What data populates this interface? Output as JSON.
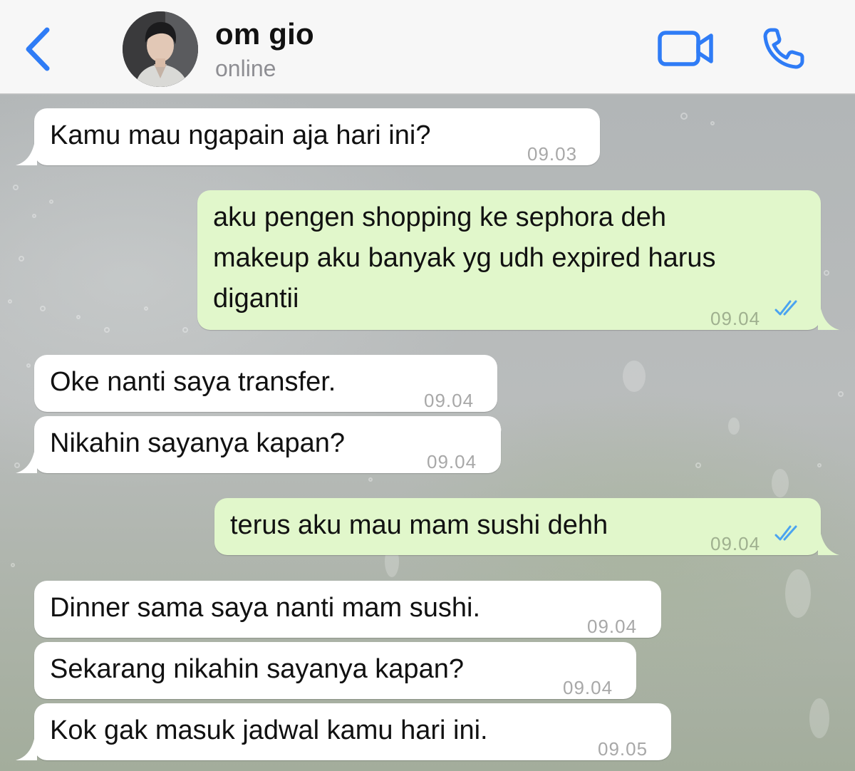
{
  "header": {
    "contact_name": "om gio",
    "status": "online"
  },
  "colors": {
    "accent": "#2f7cf6",
    "incoming_bubble": "#ffffff",
    "outgoing_bubble": "#e1f7cb",
    "read_ticks": "#4aa3f0"
  },
  "icons": {
    "back": "chevron-left-icon",
    "video": "video-camera-icon",
    "call": "phone-icon",
    "read": "double-check-icon"
  },
  "messages": [
    {
      "direction": "incoming",
      "lines": [
        "Kamu mau ngapain aja hari ini?"
      ],
      "time": "09.03"
    },
    {
      "direction": "outgoing",
      "lines": [
        "aku pengen shopping ke sephora deh",
        "makeup aku banyak yg udh expired harus",
        "digantii"
      ],
      "time": "09.04",
      "status": "read"
    },
    {
      "direction": "incoming",
      "lines": [
        "Oke nanti saya transfer."
      ],
      "time": "09.04"
    },
    {
      "direction": "incoming",
      "lines": [
        "Nikahin sayanya kapan?"
      ],
      "time": "09.04"
    },
    {
      "direction": "outgoing",
      "lines": [
        "terus aku mau mam sushi dehh"
      ],
      "time": "09.04",
      "status": "read"
    },
    {
      "direction": "incoming",
      "lines": [
        "Dinner sama saya nanti mam sushi."
      ],
      "time": "09.04"
    },
    {
      "direction": "incoming",
      "lines": [
        "Sekarang nikahin sayanya kapan?"
      ],
      "time": "09.04"
    },
    {
      "direction": "incoming",
      "lines": [
        "Kok gak masuk jadwal kamu hari ini."
      ],
      "time": "09.05"
    }
  ]
}
